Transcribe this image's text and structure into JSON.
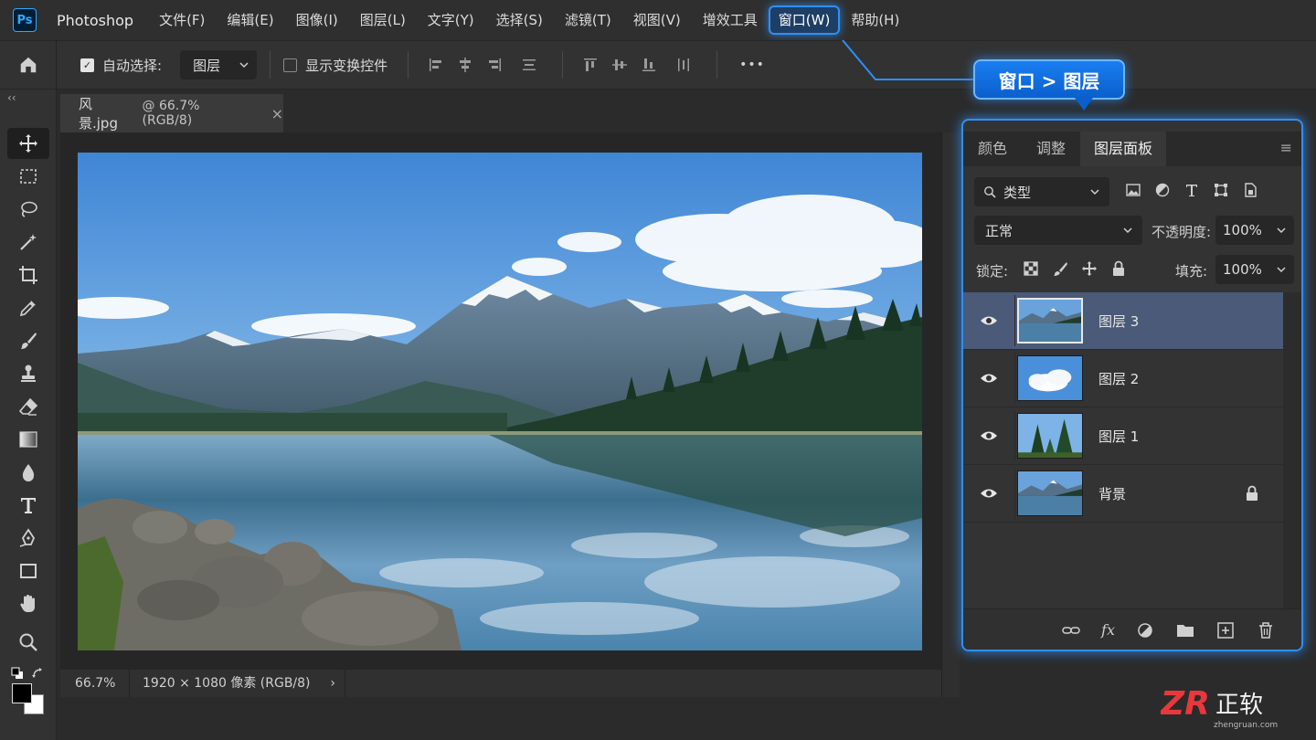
{
  "app": {
    "logo": "Ps",
    "name": "Photoshop"
  },
  "menu": [
    "文件(F)",
    "编辑(E)",
    "图像(I)",
    "图层(L)",
    "文字(Y)",
    "选择(S)",
    "滤镜(T)",
    "视图(V)",
    "增效工具",
    "窗口(W)",
    "帮助(H)"
  ],
  "menu_highlight_index": 9,
  "options": {
    "auto_select_label": "自动选择:",
    "auto_select_checked": true,
    "auto_select_value": "图层",
    "show_transform_label": "显示变换控件",
    "show_transform_checked": false,
    "more": "•••"
  },
  "toolbar": {
    "collapse": "‹‹",
    "tools": [
      "move-tool-icon",
      "marquee-tool-icon",
      "lasso-tool-icon",
      "magic-wand-tool-icon",
      "crop-tool-icon",
      "eyedropper-tool-icon",
      "brush-tool-icon",
      "clone-stamp-tool-icon",
      "eraser-tool-icon",
      "gradient-tool-icon",
      "blur-tool-icon",
      "type-tool-icon",
      "pen-tool-icon",
      "rectangle-tool-icon",
      "hand-tool-icon",
      "zoom-tool-icon"
    ],
    "active_tool": "move-tool-icon",
    "foreground_color": "#000000",
    "background_color": "#ffffff"
  },
  "document": {
    "tab_name": "风景.jpg",
    "tab_zoom": "@ 66.7% (RGB/8)",
    "close": "×"
  },
  "status": {
    "zoom": "66.7%",
    "info": "1920 × 1080 像素 (RGB/8)",
    "arrow": "›"
  },
  "callout": {
    "text": "窗口 > 图层"
  },
  "panel": {
    "tabs": [
      "颜色",
      "调整",
      "图层面板"
    ],
    "active_tab": 2,
    "menu_glyph": "≡",
    "filter_label": "类型",
    "blend_mode": "正常",
    "opacity_label": "不透明度:",
    "opacity_value": "100%",
    "lock_label": "锁定:",
    "fill_label": "填充:",
    "fill_value": "100%",
    "layers": [
      {
        "name": "图层 3",
        "visible": true,
        "selected": true,
        "locked": false,
        "thumb": "landscape"
      },
      {
        "name": "图层 2",
        "visible": true,
        "selected": false,
        "locked": false,
        "thumb": "clouds"
      },
      {
        "name": "图层 1",
        "visible": true,
        "selected": false,
        "locked": false,
        "thumb": "trees"
      },
      {
        "name": "背景",
        "visible": true,
        "selected": false,
        "locked": true,
        "thumb": "landscape"
      }
    ],
    "footer_icons": [
      "link-layers-icon",
      "fx-icon",
      "adjustment-layer-icon",
      "new-group-icon",
      "new-layer-icon",
      "delete-layer-icon"
    ],
    "fx_text": "fx"
  },
  "watermark": {
    "mark": "ZR",
    "text": "正软",
    "url": "zhengruan.com"
  },
  "colors": {
    "accent": "#2f8ff5",
    "panel_bg": "#333333",
    "selected_row": "#4a5a78"
  }
}
